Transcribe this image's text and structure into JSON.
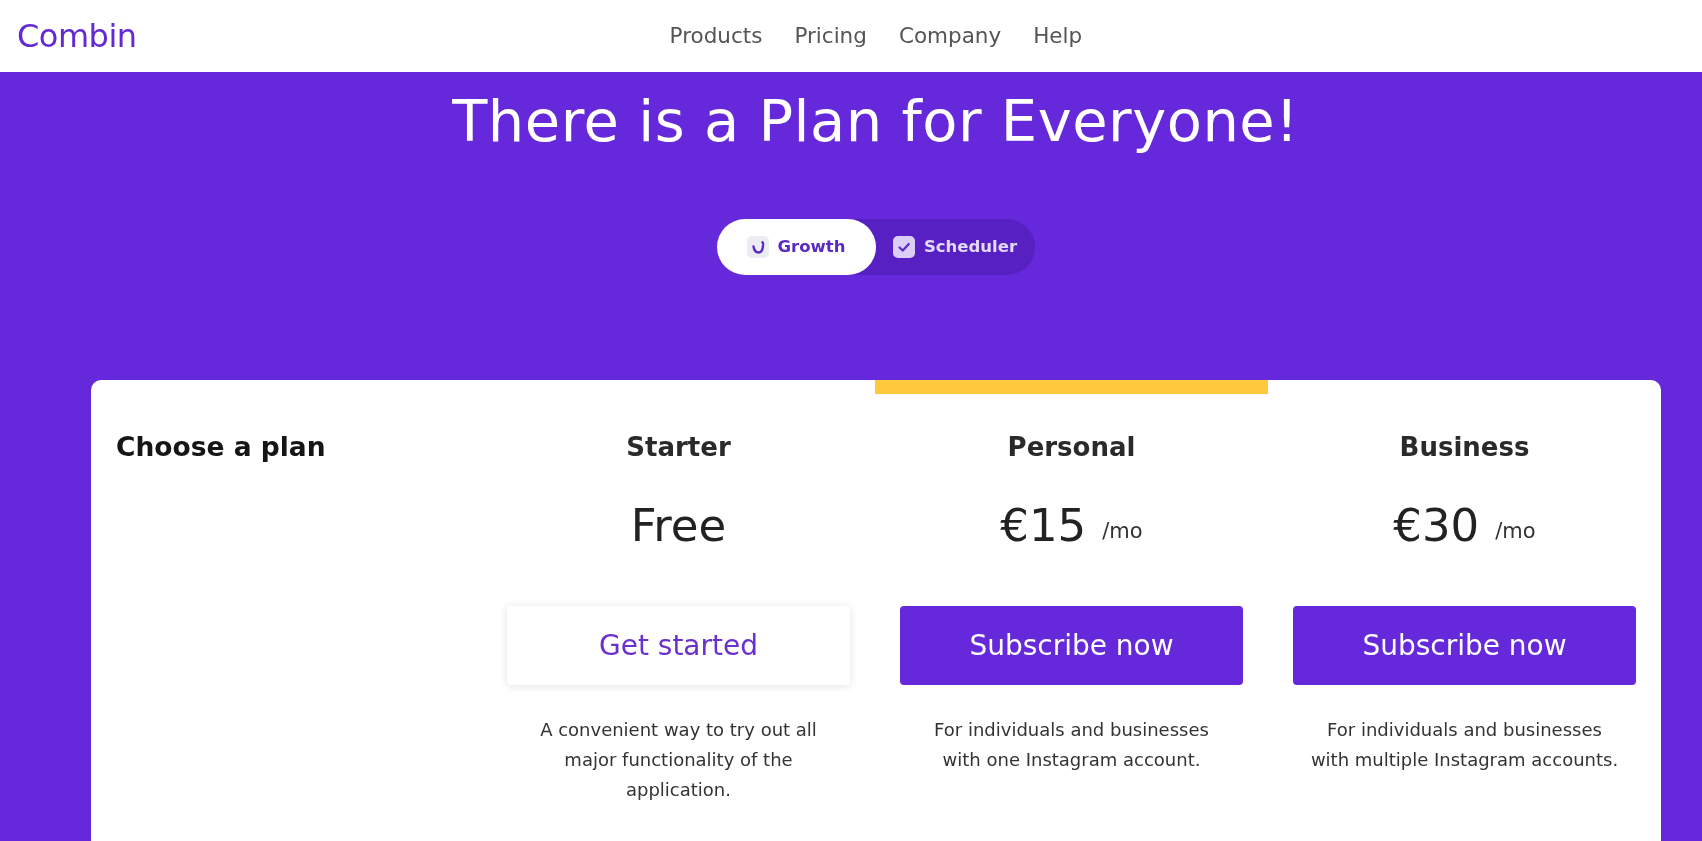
{
  "header": {
    "logo": "Combin",
    "nav": [
      "Products",
      "Pricing",
      "Company",
      "Help"
    ]
  },
  "hero": {
    "title": "There is a Plan for Everyone!",
    "tabs": [
      {
        "label": "Growth",
        "kind": "growth",
        "selected": true
      },
      {
        "label": "Scheduler",
        "kind": "scheduler",
        "selected": false
      }
    ]
  },
  "pricing": {
    "heading": "Choose a plan",
    "plans": [
      {
        "name": "Starter",
        "highlighted": false,
        "price": "Free",
        "button": {
          "label": "Get started",
          "kind": "secondary"
        },
        "description": "A convenient way to try out all major functionality of the application."
      },
      {
        "name": "Personal",
        "highlighted": true,
        "price": "€15",
        "period": "/mo",
        "button": {
          "label": "Subscribe now",
          "kind": "primary"
        },
        "description": "For individuals and businesses with one Instagram account."
      },
      {
        "name": "Business",
        "highlighted": false,
        "price": "€30",
        "period": "/mo",
        "button": {
          "label": "Subscribe now",
          "kind": "primary"
        },
        "description": "For individuals and businesses with multiple Instagram accounts."
      }
    ]
  }
}
